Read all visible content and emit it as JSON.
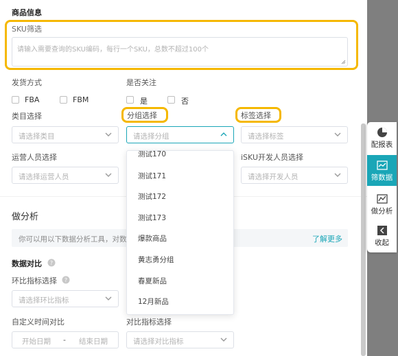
{
  "product_info": {
    "title": "商品信息"
  },
  "sku_filter": {
    "label": "SKU筛选",
    "placeholder": "请输入需要查询的SKU编码，每行一个SKU，总数不超过100个"
  },
  "shipping": {
    "label": "发货方式",
    "options": [
      "FBA",
      "FBM"
    ]
  },
  "follow": {
    "label": "是否关注",
    "options": [
      "是",
      "否"
    ]
  },
  "category": {
    "label": "类目选择",
    "placeholder": "请选择类目"
  },
  "group": {
    "label": "分组选择",
    "placeholder": "请选择分组"
  },
  "tag": {
    "label": "标签选择",
    "placeholder": "请选择标签"
  },
  "operator": {
    "label": "运营人员选择",
    "placeholder": "请选择运营人员"
  },
  "developer": {
    "label": "iSKU开发人员选择",
    "placeholder": "请选择开发人员"
  },
  "group_dropdown": {
    "options": [
      "测试170",
      "测试171",
      "测试172",
      "测试173",
      "爆款商品",
      "黄志勇分组",
      "春夏新品",
      "12月新品"
    ]
  },
  "analysis": {
    "title": "做分析",
    "banner_text": "你可以用以下数据分析工具，对数",
    "learn_more": "了解更多"
  },
  "data_compare": {
    "title": "数据对比",
    "ring_label": "环比指标选择",
    "ring_placeholder": "请选择环比指标",
    "custom_time_label": "自定义时间对比",
    "start_placeholder": "开始日期",
    "range_sep": "-",
    "end_placeholder": "结束日期",
    "compare_label": "对比指标选择",
    "compare_placeholder": "请选择对比指标"
  },
  "toolbar": {
    "items": [
      {
        "label": "配报表",
        "icon": "pie-chart-icon"
      },
      {
        "label": "筛数据",
        "icon": "filter-chart-icon"
      },
      {
        "label": "做分析",
        "icon": "line-chart-icon"
      },
      {
        "label": "收起",
        "icon": "collapse-icon"
      }
    ],
    "active_color": "#1aa6b7"
  },
  "colors": {
    "highlight": "#f5b800",
    "accent": "#1aa6b7"
  }
}
